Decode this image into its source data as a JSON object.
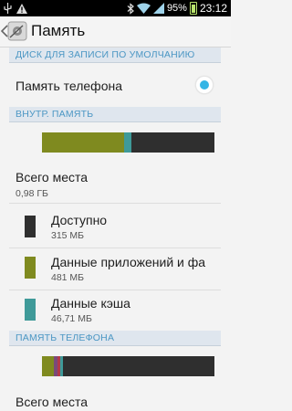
{
  "statusbar": {
    "battery": "95%",
    "time": "23:12",
    "icons": [
      "usb-icon",
      "warning-icon",
      "bluetooth-icon",
      "wifi-icon",
      "signal-icon",
      "battery-icon"
    ]
  },
  "actionbar": {
    "title": "Память"
  },
  "default_disk": {
    "header": "ДИСК ДЛЯ ЗАПИСИ ПО УМОЛЧАНИЮ",
    "option_label": "Память телефона",
    "selected": true
  },
  "internal": {
    "header": "ВНУТР. ПАМЯТЬ",
    "usage": {
      "apps_fraction": 0.475,
      "cache_fraction": 0.046,
      "free_fraction": 0.479
    },
    "total_label": "Всего места",
    "total_value": "0,98 ГБ",
    "items": [
      {
        "label": "Доступно",
        "value": "315 МБ",
        "color": "#2f2f2f"
      },
      {
        "label": "Данные приложений и фа",
        "value": "481 МБ",
        "color": "#7f8a1f"
      },
      {
        "label": "Данные кэша",
        "value": "46,71 МБ",
        "color": "#3f9a99"
      }
    ]
  },
  "phone": {
    "header": "ПАМЯТЬ ТЕЛЕФОНА",
    "usage": {
      "apps_fraction": 0.07,
      "misc1_fraction": 0.02,
      "misc2_fraction": 0.015,
      "misc3_fraction": 0.015,
      "free_fraction": 0.88
    },
    "total_label": "Всего места"
  },
  "colors": {
    "accent": "#35b5e5",
    "section_text": "#4c97c4",
    "apps": "#7f8a1f",
    "cache": "#3f9a99",
    "free": "#2f2f2f"
  }
}
